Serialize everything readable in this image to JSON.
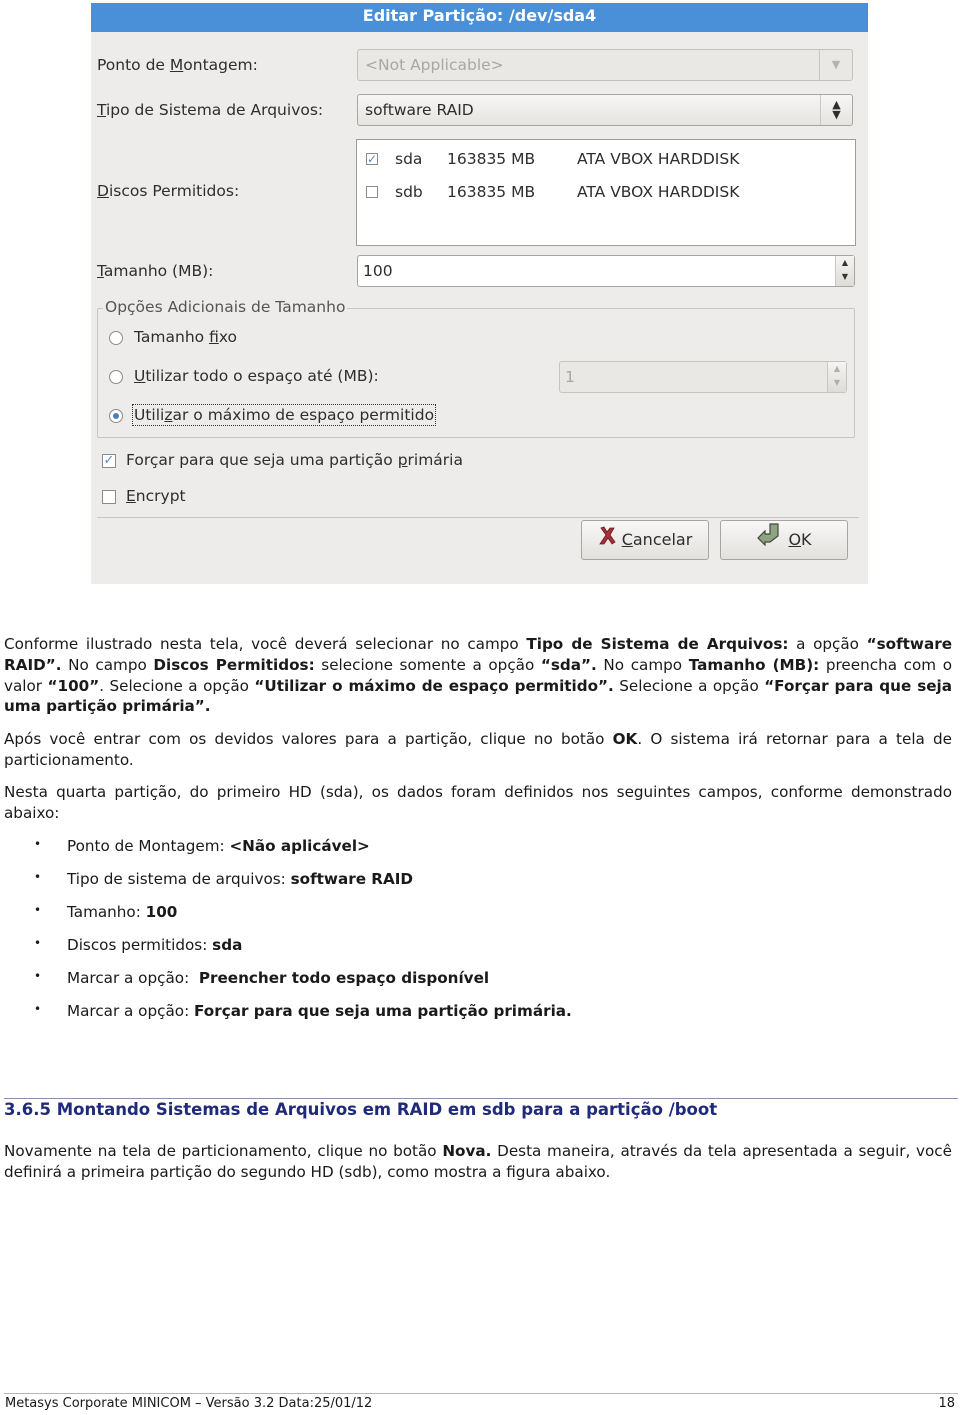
{
  "dialog": {
    "title": "Editar Partição: /dev/sda4",
    "mount_point": {
      "label_pre": "Ponto de ",
      "label_u": "M",
      "label_post": "ontagem:",
      "value": "<Not Applicable>",
      "disabled": true
    },
    "fs_type": {
      "label_u": "T",
      "label_post": "ipo de Sistema de Arquivos:",
      "value": "software RAID"
    },
    "allowed_disks": {
      "label_u": "D",
      "label_post": "iscos Permitidos:",
      "rows": [
        {
          "checked": true,
          "name": "sda",
          "size": "163835 MB",
          "model": "ATA VBOX HARDDISK"
        },
        {
          "checked": false,
          "name": "sdb",
          "size": "163835 MB",
          "model": "ATA VBOX HARDDISK"
        }
      ]
    },
    "size": {
      "label_u": "T",
      "label_post": "amanho (MB):",
      "value": "100"
    },
    "size_options": {
      "legend": "Opções Adicionais de Tamanho",
      "fixed": {
        "pre": "Tamanho ",
        "u": "f",
        "post": "ixo",
        "selected": false
      },
      "up_to": {
        "pre": "",
        "u": "U",
        "post": "tilizar todo o espaço até (MB):",
        "selected": false,
        "value": "1"
      },
      "maximum": {
        "pre": "Utili",
        "u": "z",
        "post": "ar o máximo de espaço permitido",
        "selected": true
      }
    },
    "force_primary": {
      "pre": "Forçar para que seja uma partição ",
      "u": "p",
      "post": "rimária",
      "checked": true
    },
    "encrypt": {
      "pre": "",
      "u": "E",
      "post": "ncrypt",
      "checked": false
    },
    "buttons": {
      "cancel": {
        "u": "C",
        "post": "ancelar"
      },
      "ok": {
        "u": "O",
        "post": "K"
      }
    }
  },
  "document": {
    "p1": [
      {
        "t": "Conforme ilustrado nesta tela, você deverá selecionar no campo ",
        "b": false
      },
      {
        "t": "Tipo de Sistema de Arquivos:",
        "b": true
      },
      {
        "t": " a opção ",
        "b": false
      },
      {
        "t": "“software RAID”.",
        "b": true
      },
      {
        "t": " No campo ",
        "b": false
      },
      {
        "t": "Discos Permitidos:",
        "b": true
      },
      {
        "t": " selecione somente a opção ",
        "b": false
      },
      {
        "t": "“sda”.",
        "b": true
      },
      {
        "t": " No campo ",
        "b": false
      },
      {
        "t": "Tamanho (MB):",
        "b": true
      },
      {
        "t": " preencha com o valor ",
        "b": false
      },
      {
        "t": "“100”",
        "b": true
      },
      {
        "t": ". Selecione a opção ",
        "b": false
      },
      {
        "t": "“Utilizar o máximo de espaço permitido”.",
        "b": true
      },
      {
        "t": " Selecione a opção ",
        "b": false
      },
      {
        "t": "“Forçar para que seja uma partição primária”.",
        "b": true
      }
    ],
    "p2": [
      {
        "t": "Após você entrar com os devidos valores para a partição, clique no botão ",
        "b": false
      },
      {
        "t": "OK",
        "b": true
      },
      {
        "t": ". O sistema irá retornar para a tela de particionamento.",
        "b": false
      }
    ],
    "p3": [
      {
        "t": "Nesta quarta partição, do primeiro HD (sda), os dados foram definidos nos seguintes campos, conforme demonstrado abaixo:",
        "b": false
      }
    ],
    "bullets": [
      {
        "label": "Ponto de Montagem: ",
        "value": "<Não aplicável>"
      },
      {
        "label": "Tipo de sistema de arquivos: ",
        "value": "software RAID"
      },
      {
        "label": "Tamanho: ",
        "value": "100"
      },
      {
        "label": "Discos permitidos: ",
        "value": "sda"
      },
      {
        "label": "Marcar a opção:  ",
        "value": "Preencher todo espaço disponível"
      },
      {
        "label": "Marcar a opção: ",
        "value": "Forçar para que seja uma partição primária."
      }
    ],
    "bullet_char": "•",
    "heading": "3.6.5 Montando Sistemas de Arquivos em RAID em sdb para a partição /boot",
    "p4": [
      {
        "t": "Novamente na tela de particionamento, clique no botão ",
        "b": false
      },
      {
        "t": "Nova.",
        "b": true
      },
      {
        "t": " Desta maneira, através da tela apresentada a seguir, você definirá a primeira partição do segundo HD (sdb), como mostra a figura abaixo.",
        "b": false
      }
    ]
  },
  "footer": {
    "left": "Metasys Corporate MINICOM – Versão 3.2 Data:25/01/12",
    "page": "18"
  },
  "colors": {
    "titlebar": "#4a90d9",
    "heading": "#1f2a7a",
    "check_accent": "#5a8bc4"
  }
}
